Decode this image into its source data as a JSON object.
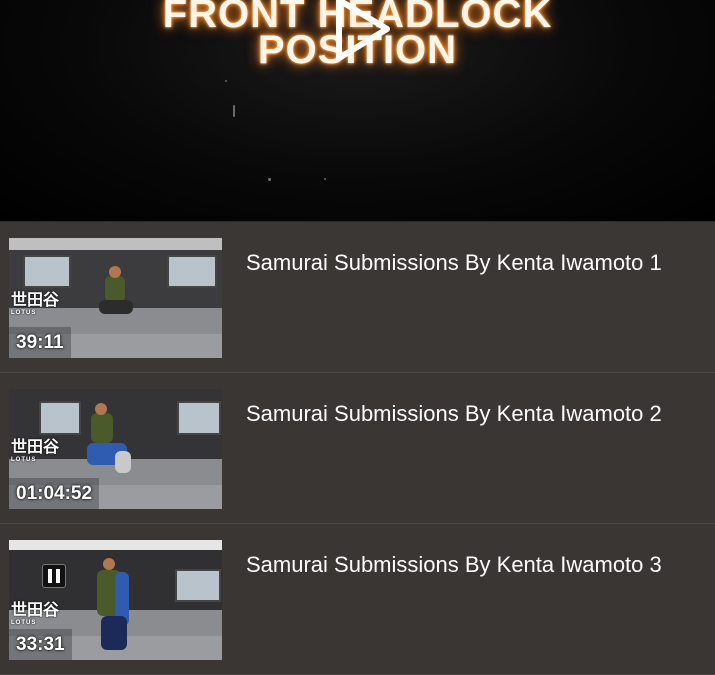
{
  "hero": {
    "title_line1": "FRONT HEADLOCK",
    "title_line2": "POSITION",
    "play_icon": "play-icon"
  },
  "videos": [
    {
      "title": "Samurai Submissions By Kenta Iwamoto 1",
      "duration": "39:11",
      "logo_text": "世田谷",
      "logo_sub": "LOTUS",
      "state": "default"
    },
    {
      "title": "Samurai Submissions By Kenta Iwamoto 2",
      "duration": "01:04:52",
      "logo_text": "世田谷",
      "logo_sub": "LOTUS",
      "state": "default"
    },
    {
      "title": "Samurai Submissions By Kenta Iwamoto 3",
      "duration": "33:31",
      "logo_text": "世田谷",
      "logo_sub": "LOTUS",
      "state": "paused",
      "overlay_icon": "pause-icon"
    }
  ]
}
